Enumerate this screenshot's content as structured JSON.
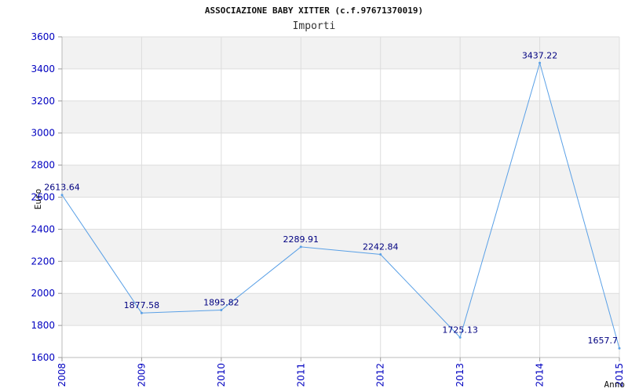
{
  "chart_data": {
    "type": "line",
    "title": "ASSOCIAZIONE BABY XITTER (c.f.97671370019)",
    "subtitle": "Importi",
    "xlabel": "Anno",
    "ylabel": "Euro",
    "categories": [
      "2008",
      "2009",
      "2010",
      "2011",
      "2012",
      "2013",
      "2014",
      "2015"
    ],
    "series": [
      {
        "values": [
          2613.64,
          1877.58,
          1895.82,
          2289.91,
          2242.84,
          1725.13,
          3437.22,
          1657.7
        ],
        "labels": [
          "2613.64",
          "1877.58",
          "1895.82",
          "2289.91",
          "2242.84",
          "1725.13",
          "3437.22",
          "1657.7"
        ],
        "color": "#5aa0e6"
      }
    ],
    "yticks": [
      "1600",
      "1800",
      "2000",
      "2200",
      "2400",
      "2600",
      "2800",
      "3000",
      "3200",
      "3400",
      "3600"
    ],
    "ylim": [
      1600,
      3600
    ],
    "grid": true,
    "band_colors": [
      "#f2f2f2",
      "#ffffff"
    ],
    "tick_color": "#0000c0",
    "label_color": "#000080"
  }
}
